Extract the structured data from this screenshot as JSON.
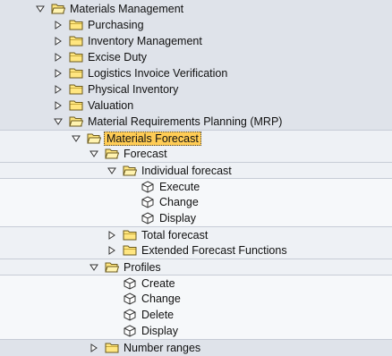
{
  "tree": {
    "n0": {
      "label": "Materials Management",
      "expanded": true,
      "icon": "folder-open-icon"
    },
    "n1": {
      "label": "Purchasing",
      "expanded": false,
      "icon": "folder-icon"
    },
    "n2": {
      "label": "Inventory Management",
      "expanded": false,
      "icon": "folder-icon"
    },
    "n3": {
      "label": "Excise Duty",
      "expanded": false,
      "icon": "folder-icon"
    },
    "n4": {
      "label": "Logistics Invoice Verification",
      "expanded": false,
      "icon": "folder-icon"
    },
    "n5": {
      "label": "Physical Inventory",
      "expanded": false,
      "icon": "folder-icon"
    },
    "n6": {
      "label": "Valuation",
      "expanded": false,
      "icon": "folder-icon"
    },
    "n7": {
      "label": "Material Requirements Planning (MRP)",
      "expanded": true,
      "icon": "folder-open-icon"
    },
    "n8": {
      "label": "Materials Forecast",
      "expanded": true,
      "selected": true,
      "icon": "folder-open-icon"
    },
    "n9": {
      "label": "Forecast",
      "expanded": true,
      "icon": "folder-open-icon"
    },
    "n10": {
      "label": "Individual forecast",
      "expanded": true,
      "icon": "folder-open-icon"
    },
    "n11": {
      "label": "Execute",
      "icon": "transaction-cube-icon"
    },
    "n12": {
      "label": "Change",
      "icon": "transaction-cube-icon"
    },
    "n13": {
      "label": "Display",
      "icon": "transaction-cube-icon"
    },
    "n14": {
      "label": "Total forecast",
      "expanded": false,
      "icon": "folder-icon"
    },
    "n15": {
      "label": "Extended Forecast Functions",
      "expanded": false,
      "icon": "folder-icon"
    },
    "n16": {
      "label": "Profiles",
      "expanded": true,
      "icon": "folder-open-icon"
    },
    "n17": {
      "label": "Create",
      "icon": "transaction-cube-icon"
    },
    "n18": {
      "label": "Change",
      "icon": "transaction-cube-icon"
    },
    "n19": {
      "label": "Delete",
      "icon": "transaction-cube-icon"
    },
    "n20": {
      "label": "Display",
      "icon": "transaction-cube-icon"
    },
    "n21": {
      "label": "Number ranges",
      "expanded": false,
      "icon": "folder-icon"
    }
  },
  "colors": {
    "background": "#dfe3ea",
    "folder_fill": "#ffe680",
    "selection_highlight": "#ffcc55"
  }
}
